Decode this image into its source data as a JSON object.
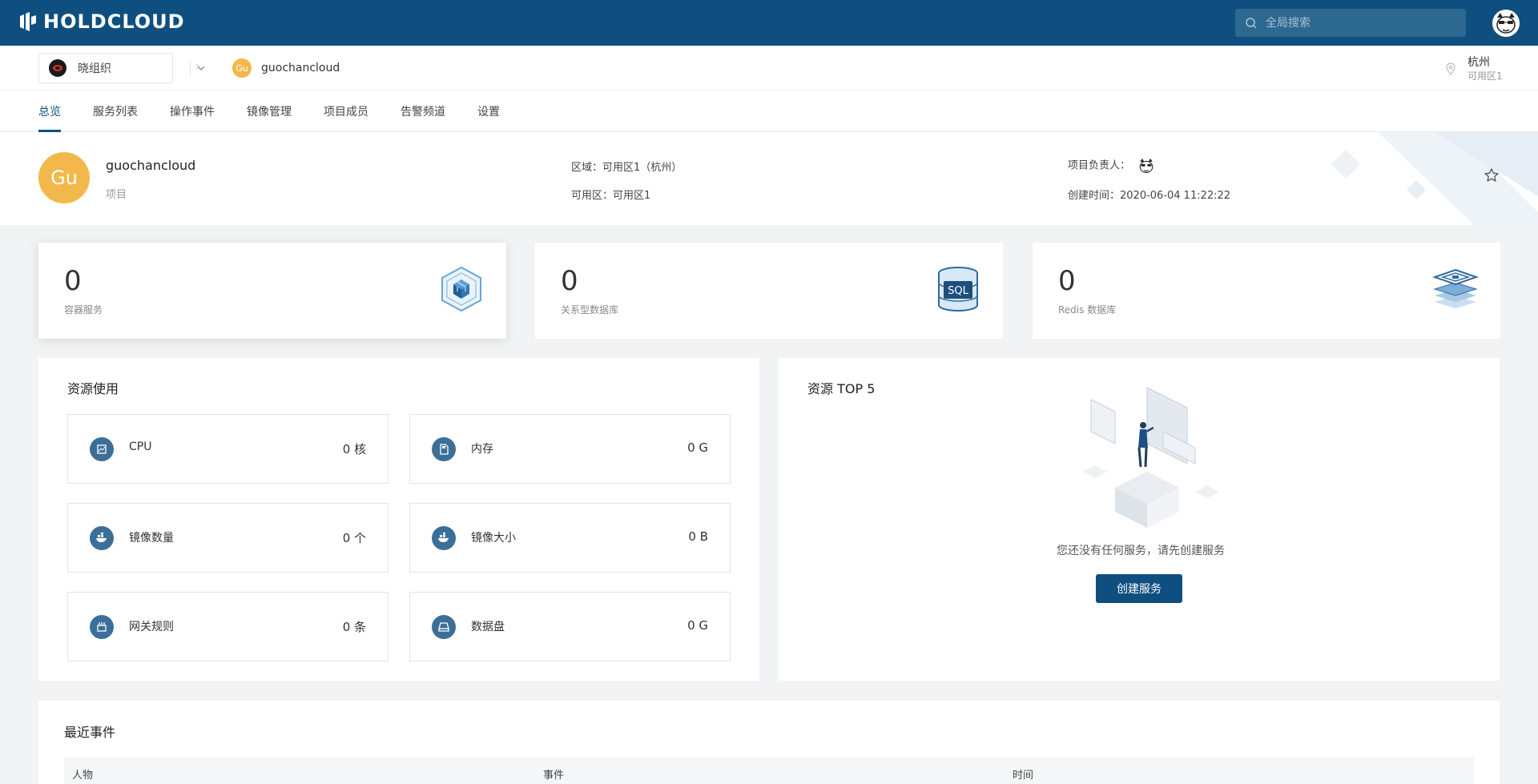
{
  "app": {
    "logo_text": "HOLDCLOUD"
  },
  "search": {
    "placeholder": "全局搜索"
  },
  "context": {
    "org_label": "晓组织",
    "project_abbrev": "Gu",
    "project_name": "guochancloud",
    "region_city": "杭州",
    "region_zone": "可用区1"
  },
  "tabs": [
    {
      "label": "总览",
      "active": true
    },
    {
      "label": "服务列表"
    },
    {
      "label": "操作事件"
    },
    {
      "label": "镜像管理"
    },
    {
      "label": "项目成员"
    },
    {
      "label": "告警频道"
    },
    {
      "label": "设置"
    }
  ],
  "project": {
    "abbrev": "Gu",
    "name": "guochancloud",
    "type": "项目",
    "region": "区域：可用区1（杭州）",
    "zone": "可用区：可用区1",
    "owner_label": "项目负责人：",
    "created": "创建时间：2020-06-04 11:22:22"
  },
  "stats": [
    {
      "value": "0",
      "label": "容器服务",
      "icon": "cube-icon"
    },
    {
      "value": "0",
      "label": "关系型数据库",
      "icon": "sql-database-icon"
    },
    {
      "value": "0",
      "label": "Redis 数据库",
      "icon": "redis-layers-icon"
    }
  ],
  "resources": {
    "title": "资源使用",
    "items": [
      {
        "name": "CPU",
        "value": "0 核",
        "icon": "cpu-icon"
      },
      {
        "name": "内存",
        "value": "0 G",
        "icon": "memory-icon"
      },
      {
        "name": "镜像数量",
        "value": "0 个",
        "icon": "docker-icon"
      },
      {
        "name": "镜像大小",
        "value": "0 B",
        "icon": "docker-icon"
      },
      {
        "name": "网关规则",
        "value": "0 条",
        "icon": "gateway-icon"
      },
      {
        "name": "数据盘",
        "value": "0 G",
        "icon": "disk-icon"
      }
    ]
  },
  "top5": {
    "title": "资源 TOP 5",
    "empty_text": "您还没有任何服务，请先创建服务",
    "button": "创建服务"
  },
  "events": {
    "title": "最近事件",
    "columns": [
      "人物",
      "事件",
      "时间"
    ]
  },
  "colors": {
    "brand": "#0f4f80",
    "accent_avatar": "#f2b84b",
    "icon_circle": "#3c6f98"
  }
}
